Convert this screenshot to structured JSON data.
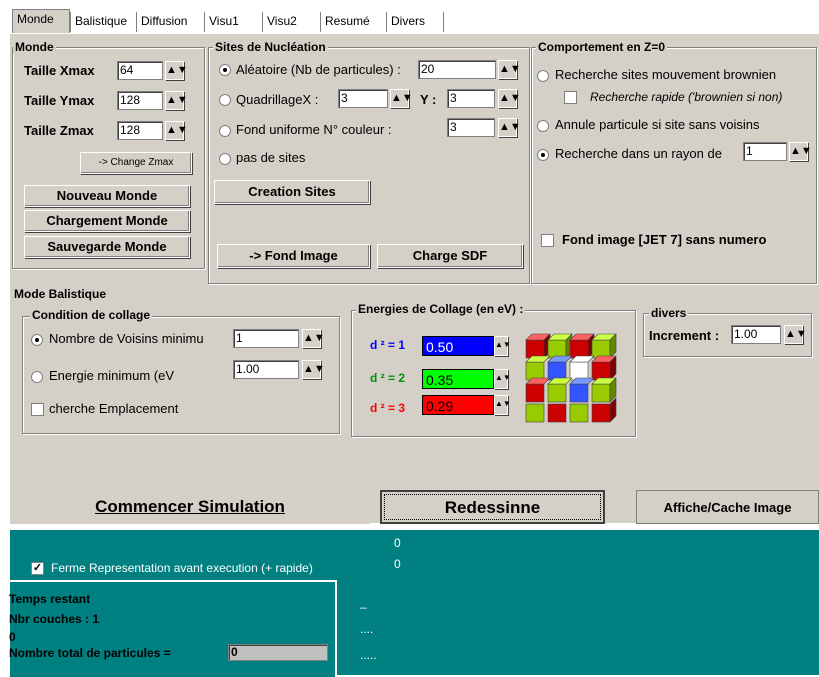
{
  "tabs": [
    "Monde",
    "Balistique",
    "Diffusion",
    "Visu1",
    "Visu2",
    "Resumé",
    "Divers"
  ],
  "monde": {
    "title": "Monde",
    "xmax_label": "Taille Xmax",
    "xmax_value": "64",
    "ymax_label": "Taille Ymax",
    "ymax_value": "128",
    "zmax_label": "Taille Zmax",
    "zmax_value": "128",
    "change_zmax": "-> Change Zmax",
    "nouveau": "Nouveau Monde",
    "chargement": "Chargement Monde",
    "sauvegarde": "Sauvegarde Monde"
  },
  "sites": {
    "title": "Sites de Nucléation",
    "aleatoire": "Aléatoire (Nb de particules) :",
    "aleatoire_value": "20",
    "quadrillage": "QuadrillageX :",
    "quad_x": "3",
    "quad_y_label": "Y :",
    "quad_y": "3",
    "fond": "Fond uniforme N° couleur :",
    "fond_value": "3",
    "pas": "pas de sites",
    "creation": "Creation Sites",
    "fond_image": "-> Fond Image",
    "charge_sdf": "Charge SDF"
  },
  "comportement": {
    "title": "Comportement en Z=0",
    "recherche_brownien": "Recherche sites mouvement brownien",
    "recherche_rapide": "Recherche rapide ('brownien si non)",
    "annule": "Annule particule si site sans voisins",
    "rayon": "Recherche dans un rayon de",
    "rayon_value": "1",
    "fond_jet": "Fond image [JET 7] sans numero"
  },
  "balistique": {
    "title": "Mode Balistique",
    "condition_title": "Condition de collage",
    "voisins": "Nombre de Voisins minimu",
    "voisins_value": "1",
    "energie": "Energie minimum (eV",
    "energie_value": "1.00",
    "cherche": "cherche Emplacement"
  },
  "energies": {
    "title": "Energies de Collage (en eV) :",
    "d1_label": "d ² = 1",
    "d1": "0.50",
    "d2_label": "d ² = 2",
    "d2": "0.35",
    "d3_label": "d ² = 3",
    "d3": "0.29",
    "colors": {
      "d1": "#0000ff",
      "d2": "#00ff00",
      "d3": "#ff0000"
    }
  },
  "divers": {
    "title": "divers",
    "increment_label": "Increment :",
    "increment_value": "1.00"
  },
  "actions": {
    "commencer": "Commencer Simulation",
    "redessinne": "Redessinne",
    "affiche": "Affiche/Cache Image"
  },
  "status": {
    "zero1": "0",
    "zero2": "0",
    "ferme": "Ferme Representation avant execution (+ rapide)",
    "temps": "Temps restant",
    "couches": "Nbr couches :  1",
    "zero3": "0",
    "total_label": "Nombre total de particules =",
    "total_value": "0",
    "dash": "_",
    "dots1": "....",
    "dots2": "....."
  }
}
